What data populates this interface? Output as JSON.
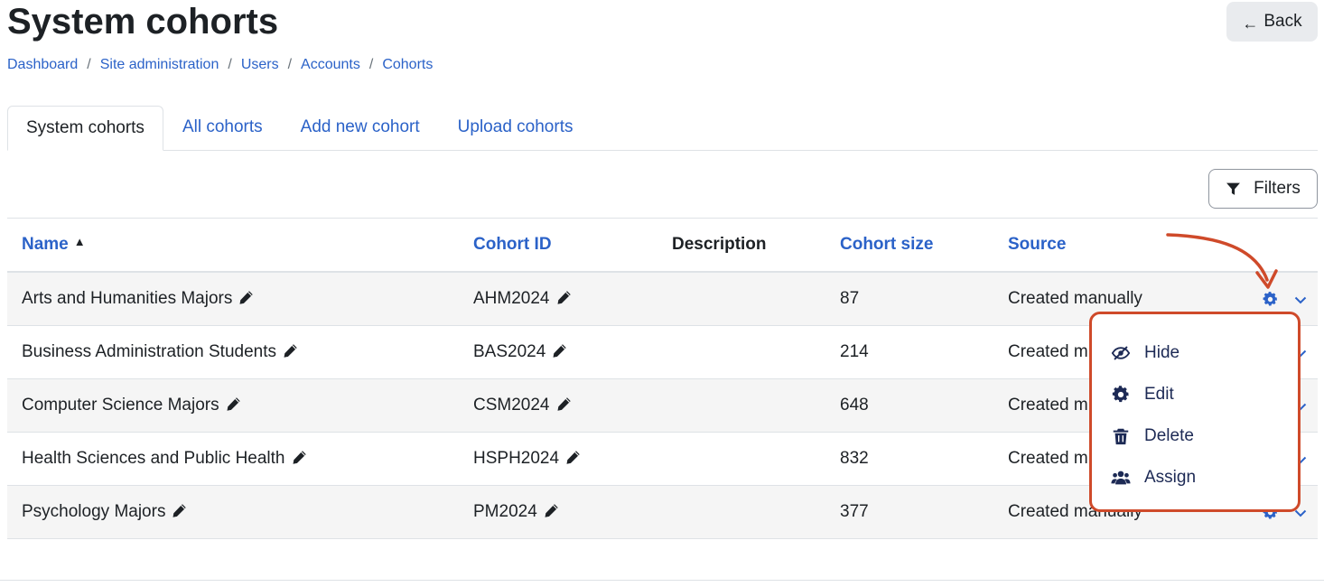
{
  "header": {
    "title": "System cohorts",
    "back_label": "Back"
  },
  "breadcrumb": [
    "Dashboard",
    "Site administration",
    "Users",
    "Accounts",
    "Cohorts"
  ],
  "tabs": [
    {
      "label": "System cohorts",
      "active": true
    },
    {
      "label": "All cohorts",
      "active": false
    },
    {
      "label": "Add new cohort",
      "active": false
    },
    {
      "label": "Upload cohorts",
      "active": false
    }
  ],
  "filters_label": "Filters",
  "table": {
    "columns": {
      "name": "Name",
      "cohort_id": "Cohort ID",
      "description": "Description",
      "cohort_size": "Cohort size",
      "source": "Source"
    },
    "sorted_by": "Name",
    "sort_direction": "ascending",
    "rows": [
      {
        "name": "Arts and Humanities Majors",
        "cohort_id": "AHM2024",
        "description": "",
        "size": "87",
        "source": "Created manually"
      },
      {
        "name": "Business Administration Students",
        "cohort_id": "BAS2024",
        "description": "",
        "size": "214",
        "source": "Created m"
      },
      {
        "name": "Computer Science Majors",
        "cohort_id": "CSM2024",
        "description": "",
        "size": "648",
        "source": "Created m"
      },
      {
        "name": "Health Sciences and Public Health",
        "cohort_id": "HSPH2024",
        "description": "",
        "size": "832",
        "source": "Created m"
      },
      {
        "name": "Psychology Majors",
        "cohort_id": "PM2024",
        "description": "",
        "size": "377",
        "source": "Created manually"
      }
    ]
  },
  "action_menu": {
    "items": [
      {
        "label": "Hide",
        "icon": "eye-slash-icon"
      },
      {
        "label": "Edit",
        "icon": "gear-icon"
      },
      {
        "label": "Delete",
        "icon": "trash-icon"
      },
      {
        "label": "Assign",
        "icon": "users-icon"
      }
    ]
  },
  "colors": {
    "link": "#2b62c8",
    "text": "#1d2125",
    "menu_text": "#1d2a55",
    "annotation": "#cf4a2a",
    "row_stripe": "#f5f5f5"
  }
}
